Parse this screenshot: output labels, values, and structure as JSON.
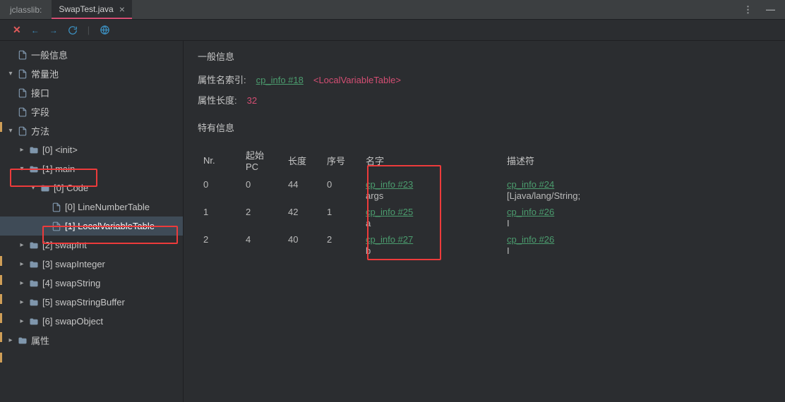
{
  "titlebar": {
    "app": "jclasslib:",
    "tab_label": "SwapTest.java"
  },
  "tree": {
    "items": [
      {
        "indent": 0,
        "chev": "",
        "icon": "file",
        "label": "一般信息"
      },
      {
        "indent": 0,
        "chev": "▾",
        "icon": "file",
        "label": "常量池"
      },
      {
        "indent": 0,
        "chev": "",
        "icon": "file",
        "label": "接口"
      },
      {
        "indent": 0,
        "chev": "",
        "icon": "file",
        "label": "字段"
      },
      {
        "indent": 0,
        "chev": "▾",
        "icon": "file",
        "label": "方法"
      },
      {
        "indent": 1,
        "chev": "▸",
        "icon": "folder",
        "label": "[0] <init>"
      },
      {
        "indent": 1,
        "chev": "▾",
        "icon": "folder",
        "label": "[1] main"
      },
      {
        "indent": 2,
        "chev": "▾",
        "icon": "folder",
        "label": "[0] Code"
      },
      {
        "indent": 3,
        "chev": "",
        "icon": "file",
        "label": "[0] LineNumberTable"
      },
      {
        "indent": 3,
        "chev": "",
        "icon": "file",
        "label": "[1] LocalVariableTable",
        "selected": true
      },
      {
        "indent": 1,
        "chev": "▸",
        "icon": "folder",
        "label": "[2] swapInt"
      },
      {
        "indent": 1,
        "chev": "▸",
        "icon": "folder",
        "label": "[3] swapInteger"
      },
      {
        "indent": 1,
        "chev": "▸",
        "icon": "folder",
        "label": "[4] swapString"
      },
      {
        "indent": 1,
        "chev": "▸",
        "icon": "folder",
        "label": "[5] swapStringBuffer"
      },
      {
        "indent": 1,
        "chev": "▸",
        "icon": "folder",
        "label": "[6] swapObject"
      },
      {
        "indent": 0,
        "chev": "▸",
        "icon": "folder",
        "label": "属性"
      }
    ]
  },
  "content": {
    "section1_title": "一般信息",
    "kv1_label": "属性名索引:",
    "kv1_link": "cp_info #18",
    "kv1_name": "<LocalVariableTable>",
    "kv2_label": "属性长度:",
    "kv2_value": "32",
    "section2_title": "特有信息",
    "headers": {
      "nr": "Nr.",
      "startpc": "起始PC",
      "length": "长度",
      "index": "序号",
      "name": "名字",
      "descriptor": "描述符"
    },
    "rows": [
      {
        "nr": "0",
        "startpc": "0",
        "length": "44",
        "index": "0",
        "name_link": "cp_info #23",
        "name_text": "args",
        "desc_link": "cp_info #24",
        "desc_text": "[Ljava/lang/String;"
      },
      {
        "nr": "1",
        "startpc": "2",
        "length": "42",
        "index": "1",
        "name_link": "cp_info #25",
        "name_text": "a",
        "desc_link": "cp_info #26",
        "desc_text": "I"
      },
      {
        "nr": "2",
        "startpc": "4",
        "length": "40",
        "index": "2",
        "name_link": "cp_info #27",
        "name_text": "b",
        "desc_link": "cp_info #26",
        "desc_text": "I"
      }
    ]
  }
}
